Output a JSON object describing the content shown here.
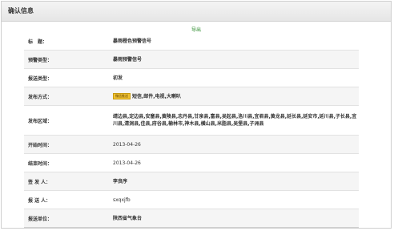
{
  "header": {
    "title": "确认信息"
  },
  "export_link": "导出",
  "rows": [
    {
      "label": "标　题：",
      "value": "暴雨橙色预警信号"
    },
    {
      "label": "预警类型：",
      "value": "暴雨预警信号"
    },
    {
      "label": "报送类型：",
      "value": "初发"
    },
    {
      "label": "发布方式：",
      "badge": "微信推送",
      "value": "短信,邮件,电视,大喇叭"
    },
    {
      "label": "发布区域：",
      "value": "靖边县,定边县,安塞县,黄陵县,志丹县,甘泉县,富县,吴起县,洛川县,宜君县,黄龙县,延长县,延安市,延川县,子长县,宜川县,清涧县,佳县,府谷县,榆林市,神木县,横山县,米脂县,吴堡县,子洲县"
    },
    {
      "label": "开始时间：",
      "value": "2013-04-26"
    },
    {
      "label": "结束时间：",
      "value": "2013-04-26"
    },
    {
      "label": "签 发 人：",
      "value": "李良序"
    },
    {
      "label": "报 送 人：",
      "value": "sxqxjfb"
    },
    {
      "label": "报送单位：",
      "value": "陕西省气象台"
    }
  ]
}
